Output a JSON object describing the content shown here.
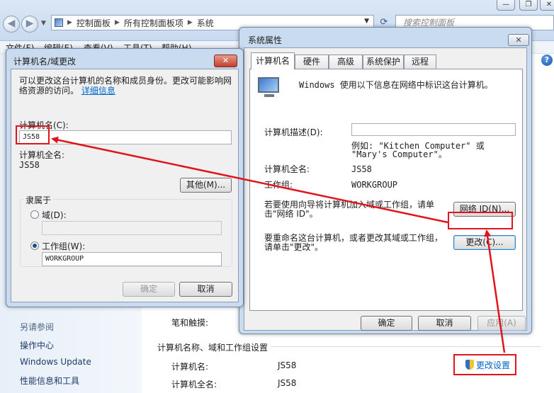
{
  "explorer": {
    "window_buttons": [
      "—",
      "❐",
      "✕"
    ],
    "breadcrumb": [
      "控制面板",
      "所有控制面板项",
      "系统"
    ],
    "search_placeholder": "搜索控制面板",
    "menu": [
      "文件(F)",
      "编辑(E)",
      "查看(V)",
      "工具(T)",
      "帮助(H)"
    ],
    "see_also": "另请参阅",
    "left_links": [
      "操作中心",
      "Windows Update",
      "性能信息和工具"
    ],
    "section_title": "计算机名称、域和工作组设置",
    "rows": [
      {
        "label": "计算机名:",
        "value": "JS58"
      },
      {
        "label": "计算机全名:",
        "value": "JS58"
      }
    ],
    "partial_row_label": "笔和触摸:",
    "change_settings": "更改设置"
  },
  "sysprops": {
    "title": "系统属性",
    "close": "✕",
    "tabs": [
      "计算机名",
      "硬件",
      "高级",
      "系统保护",
      "远程"
    ],
    "intro": "Windows 使用以下信息在网络中标识这台计算机。",
    "desc_label": "计算机描述(D):",
    "desc_value": "",
    "example": "例如: \"Kitchen Computer\" 或 \"Mary's Computer\"。",
    "full_name_label": "计算机全名:",
    "full_name_value": "JS58",
    "workgroup_label": "工作组:",
    "workgroup_value": "WORKGROUP",
    "network_text": "若要使用向导将计算机加入域或工作组，请单击\"网络 ID\"。",
    "network_button": "网络 ID(N)...",
    "rename_text": "要重命名这台计算机，或者更改其域或工作组，请单击\"更改\"。",
    "change_button": "更改(C)...",
    "ok": "确定",
    "cancel": "取消",
    "apply": "应用(A)"
  },
  "namechange": {
    "title": "计算机名/域更改",
    "close": "✕",
    "intro": "可以更改这台计算机的名称和成员身份。更改可能影响网络资源的访问。",
    "more_info": "详细信息",
    "name_label": "计算机名(C):",
    "name_value": "JS58",
    "full_name_label": "计算机全名:",
    "full_name_value": "JS58",
    "more_button": "其他(M)...",
    "member_of": "隶属于",
    "domain_label": "域(D):",
    "domain_value": "",
    "workgroup_label": "工作组(W):",
    "workgroup_value": "WORKGROUP",
    "ok": "确定",
    "cancel": "取消"
  },
  "colors": {
    "annotation": "#e0141a",
    "link": "#0066cc",
    "dialog_frame": "#c9dbef"
  }
}
